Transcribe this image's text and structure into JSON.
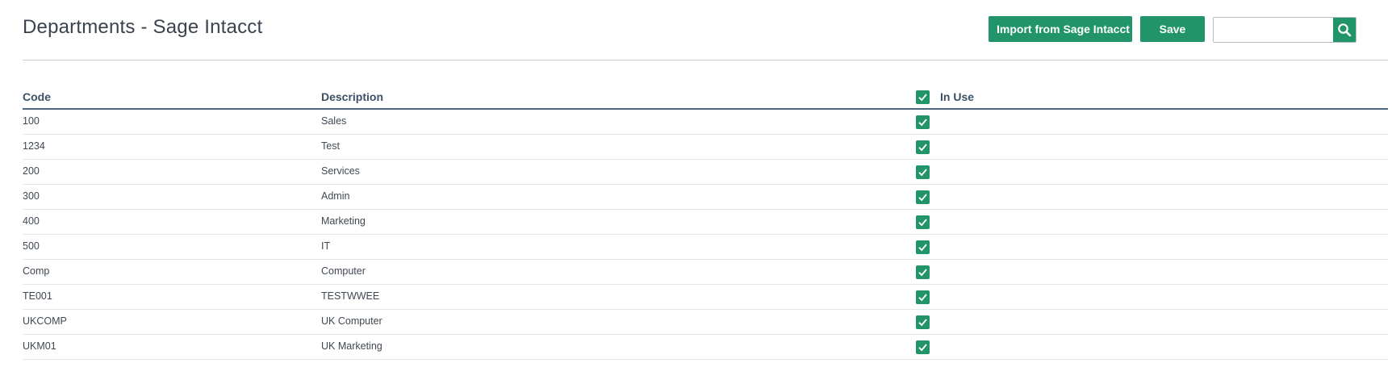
{
  "page": {
    "title": "Departments - Sage Intacct"
  },
  "toolbar": {
    "import_label": "Import from Sage Intacct",
    "save_label": "Save",
    "search_value": "",
    "search_icon": "search-icon"
  },
  "table": {
    "headers": {
      "code": "Code",
      "description": "Description",
      "in_use": "In Use"
    },
    "header_in_use_checked": true,
    "rows": [
      {
        "code": "100",
        "description": "Sales",
        "in_use": true
      },
      {
        "code": "1234",
        "description": "Test",
        "in_use": true
      },
      {
        "code": "200",
        "description": "Services",
        "in_use": true
      },
      {
        "code": "300",
        "description": "Admin",
        "in_use": true
      },
      {
        "code": "400",
        "description": "Marketing",
        "in_use": true
      },
      {
        "code": "500",
        "description": "IT",
        "in_use": true
      },
      {
        "code": "Comp",
        "description": "Computer",
        "in_use": true
      },
      {
        "code": "TE001",
        "description": "TESTWWEE",
        "in_use": true
      },
      {
        "code": "UKCOMP",
        "description": "UK Computer",
        "in_use": true
      },
      {
        "code": "UKM01",
        "description": "UK Marketing",
        "in_use": true
      }
    ]
  },
  "colors": {
    "accent": "#21946a",
    "header_rule": "#4f6680",
    "divider": "#c9cdd1"
  }
}
